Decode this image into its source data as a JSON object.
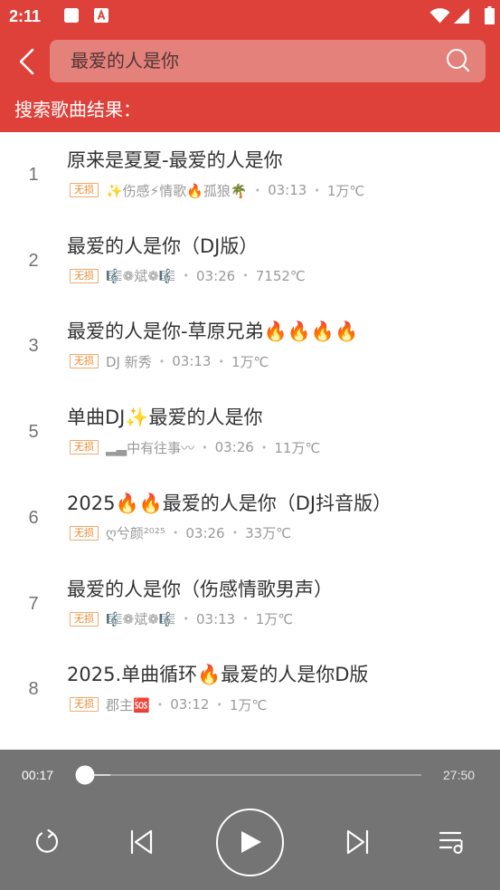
{
  "status_bar": {
    "time": "2:11"
  },
  "header": {
    "search_query": "最爱的人是你",
    "results_label": "搜索歌曲结果："
  },
  "colors": {
    "accent": "#de4139",
    "badge": "#e98a30",
    "player_background": "#747474",
    "title_text": "#333333",
    "meta_text": "#9a9a9a"
  },
  "icons": {
    "back": "back-arrow-icon",
    "search": "search-icon",
    "repeat": "repeat-icon",
    "previous": "previous-track-icon",
    "play": "play-icon",
    "next": "next-track-icon",
    "playlist": "playlist-icon"
  },
  "list": {
    "separator": "•"
  },
  "songs": [
    {
      "index": "1",
      "title": "原来是夏夏-最爱的人是你",
      "badge": "无损",
      "artist": "✨伤感⚡情歌🔥孤狼🌴",
      "duration": "03:13",
      "heat": "1万℃"
    },
    {
      "index": "2",
      "title": "最爱的人是你（DJ版）",
      "badge": "无损",
      "artist": "🎼❁斌❁🎼",
      "duration": "03:26",
      "heat": "7152℃"
    },
    {
      "index": "3",
      "title": "最爱的人是你-草原兄弟🔥🔥🔥🔥",
      "badge": "无损",
      "artist": "DJ 新秀",
      "duration": "03:13",
      "heat": "1万℃"
    },
    {
      "index": "5",
      "title": "单曲DJ✨最爱的人是你",
      "badge": "无损",
      "artist": "▂▃中有往事〰",
      "duration": "03:26",
      "heat": "11万℃"
    },
    {
      "index": "6",
      "title": "2025🔥🔥最爱的人是你（DJ抖音版）",
      "badge": "无损",
      "artist": "ღ兮颜²⁰²⁵",
      "duration": "03:26",
      "heat": "33万℃"
    },
    {
      "index": "7",
      "title": "最爱的人是你（伤感情歌男声）",
      "badge": "无损",
      "artist": "🎼❁斌❁🎼",
      "duration": "03:13",
      "heat": "1万℃"
    },
    {
      "index": "8",
      "title": "2025.单曲循环🔥最爱的人是你D版",
      "badge": "无损",
      "artist": "郡主🆘",
      "duration": "03:12",
      "heat": "1万℃"
    }
  ],
  "player": {
    "current_time": "00:17",
    "total_time": "27:50",
    "progress": 0.01,
    "buffered": 0.085
  }
}
